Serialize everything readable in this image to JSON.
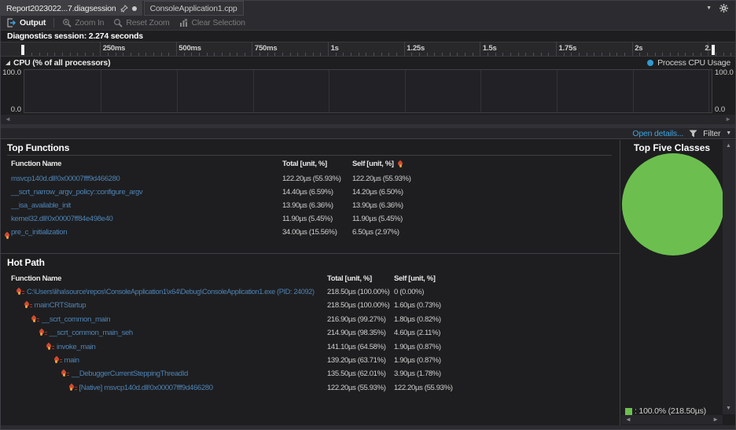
{
  "tabs": {
    "report_tab": "Report2023022...7.diagsession",
    "cpp_tab": "ConsoleApplication1.cpp"
  },
  "toolbar": {
    "output": "Output",
    "zoom_in": "Zoom In",
    "reset_zoom": "Reset Zoom",
    "clear_selection": "Clear Selection"
  },
  "session_label": "Diagnostics session: 2.274 seconds",
  "timeline_labels": [
    "250ms",
    "500ms",
    "750ms",
    "1s",
    "1.25s",
    "1.5s",
    "1.75s",
    "2s",
    "2."
  ],
  "cpu": {
    "header": "CPU (% of all processors)",
    "legend": "Process CPU Usage",
    "y_top": "100.0",
    "y_bottom": "0.0"
  },
  "details_bar": {
    "open_details": "Open details...",
    "filter": "Filter"
  },
  "top_functions": {
    "title": "Top Functions",
    "columns": [
      "Function Name",
      "Total [unit, %]",
      "Self [unit, %]"
    ],
    "rows": [
      {
        "name": "msvcp140d.dll!0x00007fff9d466280",
        "total": "122.20µs (55.93%)",
        "self": "122.20µs (55.93%)"
      },
      {
        "name": "__scrt_narrow_argv_policy::configure_argv",
        "total": "14.40µs (6.59%)",
        "self": "14.20µs (6.50%)"
      },
      {
        "name": "__isa_available_init",
        "total": "13.90µs (6.36%)",
        "self": "13.90µs (6.36%)"
      },
      {
        "name": "kernel32.dll!0x00007ff84e498e40",
        "total": "11.90µs (5.45%)",
        "self": "11.90µs (5.45%)"
      },
      {
        "name": "pre_c_initialization",
        "total": "34.00µs (15.56%)",
        "self": "6.50µs (2.97%)"
      }
    ]
  },
  "hot_path": {
    "title": "Hot Path",
    "columns": [
      "Function Name",
      "Total [unit, %]",
      "Self [unit, %]"
    ],
    "rows": [
      {
        "name": "C:\\Users\\liha\\source\\repos\\ConsoleApplication1\\x64\\Debug\\ConsoleApplication1.exe (PID: 24092)",
        "total": "218.50µs (100.00%)",
        "self": "0 (0.00%)",
        "level": 0
      },
      {
        "name": "mainCRTStartup",
        "total": "218.50µs (100.00%)",
        "self": "1.60µs (0.73%)",
        "level": 1
      },
      {
        "name": "__scrt_common_main",
        "total": "216.90µs (99.27%)",
        "self": "1.80µs (0.82%)",
        "level": 2
      },
      {
        "name": "__scrt_common_main_seh",
        "total": "214.90µs (98.35%)",
        "self": "4.60µs (2.11%)",
        "level": 3
      },
      {
        "name": "invoke_main",
        "total": "141.10µs (64.58%)",
        "self": "1.90µs (0.87%)",
        "level": 4
      },
      {
        "name": "main",
        "total": "139.20µs (63.71%)",
        "self": "1.90µs (0.87%)",
        "level": 5
      },
      {
        "name": "__DebuggerCurrentSteppingThreadId",
        "total": "135.50µs (62.01%)",
        "self": "3.90µs (1.78%)",
        "level": 6
      },
      {
        "name": "[Native] msvcp140d.dll!0x00007fff9d466280",
        "total": "122.20µs (55.93%)",
        "self": "122.20µs (55.93%)",
        "level": 7
      }
    ]
  },
  "top_five_classes": {
    "title": "Top Five Classes",
    "legend_text": ": 100.0% (218.50µs)",
    "color": "#6cbf4f"
  },
  "chart_data": [
    {
      "type": "line",
      "title": "CPU (% of all processors)",
      "series": [
        {
          "name": "Process CPU Usage",
          "values": []
        }
      ],
      "x_range_seconds": [
        0,
        2.274
      ],
      "x_ticks": [
        "250ms",
        "500ms",
        "750ms",
        "1s",
        "1.25s",
        "1.5s",
        "1.75s",
        "2s"
      ],
      "ylim": [
        0,
        100
      ],
      "grid": true,
      "note": "no visible CPU activity plotted"
    },
    {
      "type": "pie",
      "title": "Top Five Classes",
      "labels": [
        "100.0% (218.50µs)"
      ],
      "values": [
        100.0
      ],
      "colors": [
        "#6cbf4f"
      ],
      "legend_position": "bottom-left"
    }
  ]
}
